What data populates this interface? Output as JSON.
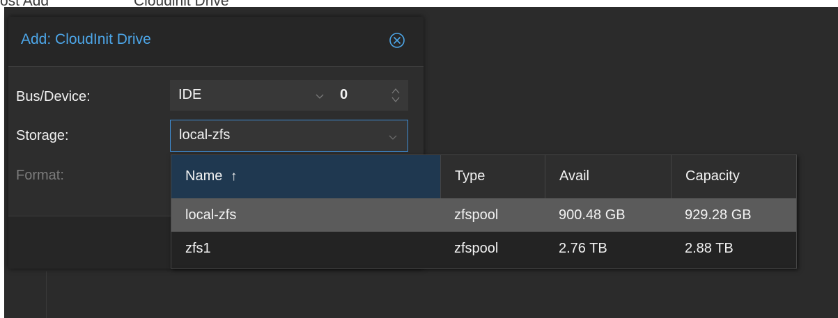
{
  "breadcrumb": {
    "left": "ost Add",
    "right": "Cloudinit Drive"
  },
  "dialog": {
    "title": "Add: CloudInit Drive",
    "labels": {
      "bus": "Bus/Device:",
      "storage": "Storage:",
      "format": "Format:"
    },
    "bus": {
      "value": "IDE",
      "device_number": "0"
    },
    "storage": {
      "value": "local-zfs"
    }
  },
  "grid": {
    "columns": [
      {
        "label": "Name",
        "sort": "↑"
      },
      {
        "label": "Type"
      },
      {
        "label": "Avail"
      },
      {
        "label": "Capacity"
      }
    ],
    "rows": [
      {
        "name": "local-zfs",
        "type": "zfspool",
        "avail": "900.48 GB",
        "capacity": "929.28 GB",
        "selected": true
      },
      {
        "name": "zfs1",
        "type": "zfspool",
        "avail": "2.76 TB",
        "capacity": "2.88 TB",
        "selected": false
      }
    ]
  },
  "colors": {
    "accent": "#4da6e8",
    "focus_border": "#3f8ed6",
    "sorted_header": "#1f3850",
    "selected_row": "#5b5b5b"
  },
  "icons": {
    "close": "close-circle-icon",
    "dropdown": "chevron-down-icon",
    "spinner": "spinner-arrows-icon",
    "sort": "sort-ascending-icon"
  }
}
